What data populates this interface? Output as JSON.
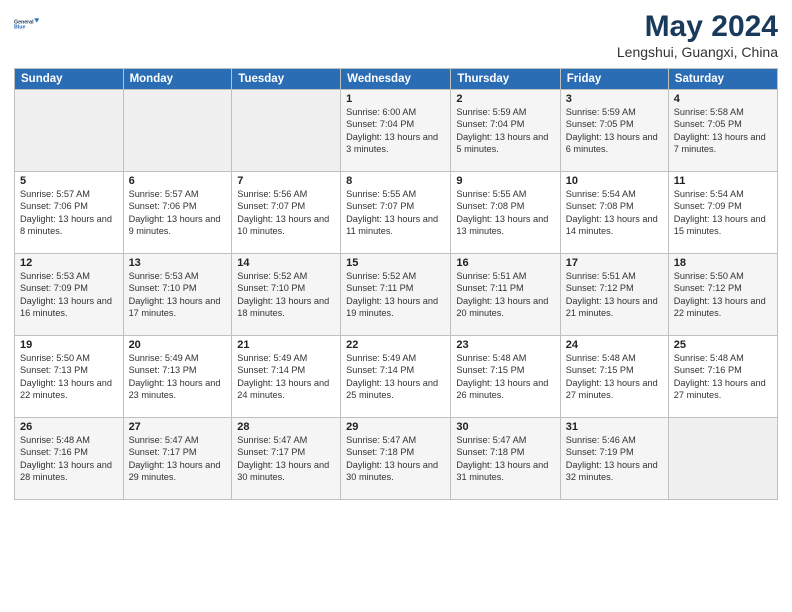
{
  "header": {
    "logo_line1": "General",
    "logo_line2": "Blue",
    "month": "May 2024",
    "location": "Lengshui, Guangxi, China"
  },
  "weekdays": [
    "Sunday",
    "Monday",
    "Tuesday",
    "Wednesday",
    "Thursday",
    "Friday",
    "Saturday"
  ],
  "weeks": [
    [
      {
        "day": "",
        "info": ""
      },
      {
        "day": "",
        "info": ""
      },
      {
        "day": "",
        "info": ""
      },
      {
        "day": "1",
        "info": "Sunrise: 6:00 AM\nSunset: 7:04 PM\nDaylight: 13 hours and 3 minutes."
      },
      {
        "day": "2",
        "info": "Sunrise: 5:59 AM\nSunset: 7:04 PM\nDaylight: 13 hours and 5 minutes."
      },
      {
        "day": "3",
        "info": "Sunrise: 5:59 AM\nSunset: 7:05 PM\nDaylight: 13 hours and 6 minutes."
      },
      {
        "day": "4",
        "info": "Sunrise: 5:58 AM\nSunset: 7:05 PM\nDaylight: 13 hours and 7 minutes."
      }
    ],
    [
      {
        "day": "5",
        "info": "Sunrise: 5:57 AM\nSunset: 7:06 PM\nDaylight: 13 hours and 8 minutes."
      },
      {
        "day": "6",
        "info": "Sunrise: 5:57 AM\nSunset: 7:06 PM\nDaylight: 13 hours and 9 minutes."
      },
      {
        "day": "7",
        "info": "Sunrise: 5:56 AM\nSunset: 7:07 PM\nDaylight: 13 hours and 10 minutes."
      },
      {
        "day": "8",
        "info": "Sunrise: 5:55 AM\nSunset: 7:07 PM\nDaylight: 13 hours and 11 minutes."
      },
      {
        "day": "9",
        "info": "Sunrise: 5:55 AM\nSunset: 7:08 PM\nDaylight: 13 hours and 13 minutes."
      },
      {
        "day": "10",
        "info": "Sunrise: 5:54 AM\nSunset: 7:08 PM\nDaylight: 13 hours and 14 minutes."
      },
      {
        "day": "11",
        "info": "Sunrise: 5:54 AM\nSunset: 7:09 PM\nDaylight: 13 hours and 15 minutes."
      }
    ],
    [
      {
        "day": "12",
        "info": "Sunrise: 5:53 AM\nSunset: 7:09 PM\nDaylight: 13 hours and 16 minutes."
      },
      {
        "day": "13",
        "info": "Sunrise: 5:53 AM\nSunset: 7:10 PM\nDaylight: 13 hours and 17 minutes."
      },
      {
        "day": "14",
        "info": "Sunrise: 5:52 AM\nSunset: 7:10 PM\nDaylight: 13 hours and 18 minutes."
      },
      {
        "day": "15",
        "info": "Sunrise: 5:52 AM\nSunset: 7:11 PM\nDaylight: 13 hours and 19 minutes."
      },
      {
        "day": "16",
        "info": "Sunrise: 5:51 AM\nSunset: 7:11 PM\nDaylight: 13 hours and 20 minutes."
      },
      {
        "day": "17",
        "info": "Sunrise: 5:51 AM\nSunset: 7:12 PM\nDaylight: 13 hours and 21 minutes."
      },
      {
        "day": "18",
        "info": "Sunrise: 5:50 AM\nSunset: 7:12 PM\nDaylight: 13 hours and 22 minutes."
      }
    ],
    [
      {
        "day": "19",
        "info": "Sunrise: 5:50 AM\nSunset: 7:13 PM\nDaylight: 13 hours and 22 minutes."
      },
      {
        "day": "20",
        "info": "Sunrise: 5:49 AM\nSunset: 7:13 PM\nDaylight: 13 hours and 23 minutes."
      },
      {
        "day": "21",
        "info": "Sunrise: 5:49 AM\nSunset: 7:14 PM\nDaylight: 13 hours and 24 minutes."
      },
      {
        "day": "22",
        "info": "Sunrise: 5:49 AM\nSunset: 7:14 PM\nDaylight: 13 hours and 25 minutes."
      },
      {
        "day": "23",
        "info": "Sunrise: 5:48 AM\nSunset: 7:15 PM\nDaylight: 13 hours and 26 minutes."
      },
      {
        "day": "24",
        "info": "Sunrise: 5:48 AM\nSunset: 7:15 PM\nDaylight: 13 hours and 27 minutes."
      },
      {
        "day": "25",
        "info": "Sunrise: 5:48 AM\nSunset: 7:16 PM\nDaylight: 13 hours and 27 minutes."
      }
    ],
    [
      {
        "day": "26",
        "info": "Sunrise: 5:48 AM\nSunset: 7:16 PM\nDaylight: 13 hours and 28 minutes."
      },
      {
        "day": "27",
        "info": "Sunrise: 5:47 AM\nSunset: 7:17 PM\nDaylight: 13 hours and 29 minutes."
      },
      {
        "day": "28",
        "info": "Sunrise: 5:47 AM\nSunset: 7:17 PM\nDaylight: 13 hours and 30 minutes."
      },
      {
        "day": "29",
        "info": "Sunrise: 5:47 AM\nSunset: 7:18 PM\nDaylight: 13 hours and 30 minutes."
      },
      {
        "day": "30",
        "info": "Sunrise: 5:47 AM\nSunset: 7:18 PM\nDaylight: 13 hours and 31 minutes."
      },
      {
        "day": "31",
        "info": "Sunrise: 5:46 AM\nSunset: 7:19 PM\nDaylight: 13 hours and 32 minutes."
      },
      {
        "day": "",
        "info": ""
      }
    ]
  ]
}
